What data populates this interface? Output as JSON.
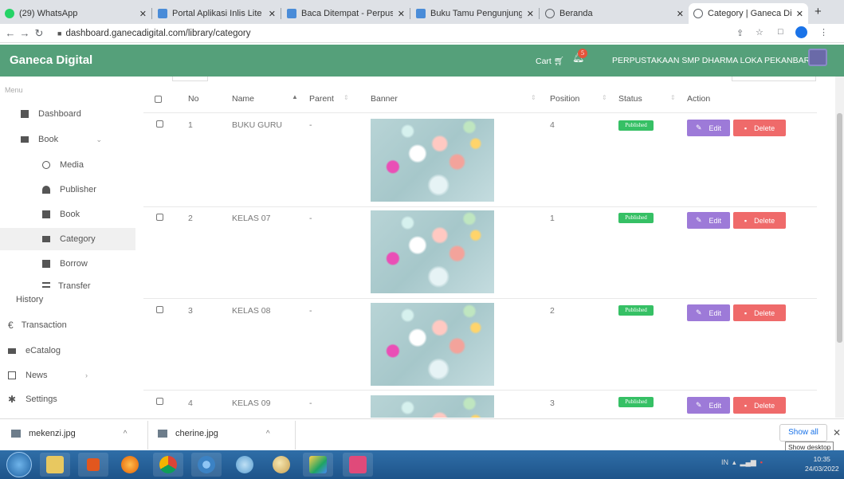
{
  "browser": {
    "tabs": [
      {
        "label": "(29) WhatsApp",
        "color": "#25d366"
      },
      {
        "label": "Portal Aplikasi Inlis Lite",
        "color": "#4a8cd8"
      },
      {
        "label": "Baca Ditempat - Perpus",
        "color": "#4a8cd8"
      },
      {
        "label": "Buku Tamu Pengunjung",
        "color": "#4a8cd8"
      },
      {
        "label": "Beranda",
        "color": "#5f6368"
      },
      {
        "label": "Category | Ganeca Digi",
        "color": "#5f6368"
      }
    ],
    "url": "dashboard.ganecadigital.com/library/category"
  },
  "app": {
    "brand": "Ganeca Digital",
    "cart_label": "Cart",
    "notification_count": "5",
    "library_name": "PERPUSTAKAAN SMP DHARMA LOKA PEKANBARU",
    "brand_color": "#55a07a"
  },
  "sidebar": {
    "menu_label": "Menu",
    "items": [
      {
        "label": "Dashboard",
        "icon": "grid-icon"
      },
      {
        "label": "Book",
        "icon": "list-icon"
      },
      {
        "label": "Media",
        "icon": "upload-icon"
      },
      {
        "label": "Publisher",
        "icon": "user-icon"
      },
      {
        "label": "Book",
        "icon": "book-icon"
      },
      {
        "label": "Category",
        "icon": "folder-icon"
      },
      {
        "label": "Borrow",
        "icon": "book-icon"
      },
      {
        "label": "Transfer History",
        "icon": "transfer-icon"
      },
      {
        "label": "Transaction",
        "icon": "euro-icon"
      },
      {
        "label": "eCatalog",
        "icon": "cart-icon"
      },
      {
        "label": "News",
        "icon": "news-icon"
      },
      {
        "label": "Settings",
        "icon": "gear-icon"
      }
    ]
  },
  "table": {
    "headers": {
      "no": "No",
      "name": "Name",
      "parent": "Parent",
      "banner": "Banner",
      "position": "Position",
      "status": "Status",
      "action": "Action"
    },
    "rows": [
      {
        "no": "1",
        "name": "BUKU GURU",
        "parent": "-",
        "position": "4",
        "status": "Published"
      },
      {
        "no": "2",
        "name": "KELAS 07",
        "parent": "-",
        "position": "1",
        "status": "Published"
      },
      {
        "no": "3",
        "name": "KELAS 08",
        "parent": "-",
        "position": "2",
        "status": "Published"
      },
      {
        "no": "4",
        "name": "KELAS 09",
        "parent": "-",
        "position": "3",
        "status": "Published"
      }
    ],
    "edit_label": "Edit",
    "delete_label": "Delete"
  },
  "downloads": {
    "files": [
      "mekenzi.jpg",
      "cherine.jpg"
    ],
    "show_all": "Show all",
    "tooltip": "Show desktop"
  },
  "taskbar": {
    "lang": "IN",
    "time": "10:35",
    "date": "24/03/2022"
  }
}
